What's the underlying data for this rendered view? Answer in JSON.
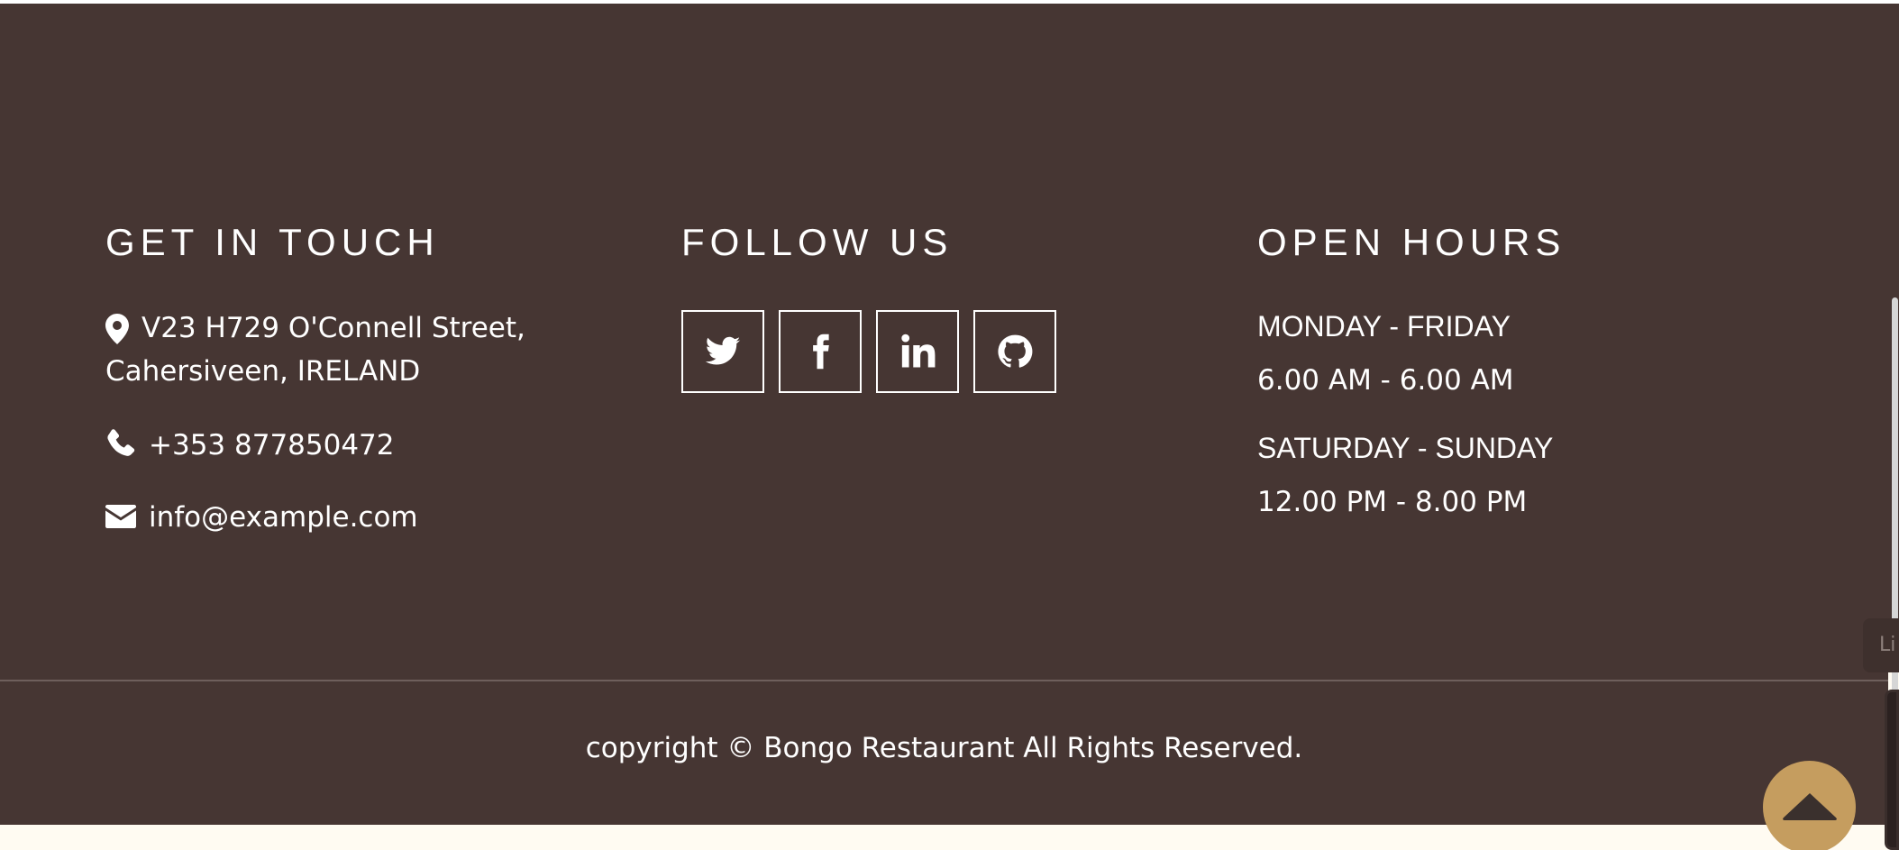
{
  "contact": {
    "heading": "GET IN TOUCH",
    "address_line1": "V23 H729 O'Connell Street,",
    "address_line2": "Cahersiveen, IRELAND",
    "phone": "+353 877850472",
    "email": "info@example.com",
    "icons": [
      "map-marker-icon",
      "phone-icon",
      "envelope-icon"
    ]
  },
  "social": {
    "heading": "FOLLOW US",
    "links": [
      {
        "icon": "twitter-icon"
      },
      {
        "icon": "facebook-icon"
      },
      {
        "icon": "linkedin-icon"
      },
      {
        "icon": "github-icon"
      }
    ]
  },
  "hours": {
    "heading": "OPEN HOURS",
    "weekday_label": "MONDAY - FRIDAY",
    "weekday_time": "6.00 AM - 6.00 AM",
    "weekend_label": "SATURDAY - SUNDAY",
    "weekend_time": "12.00 PM - 8.00 PM"
  },
  "copyright": "copyright © Bongo Restaurant All Rights Reserved.",
  "right_tab_text": "Li",
  "scroll_top": {
    "icon": "chevron-up-icon"
  },
  "colors": {
    "footer_bg": "#463633",
    "accent": "#c59d5f",
    "text": "#ffffff",
    "page_bg": "#fffbf2"
  }
}
